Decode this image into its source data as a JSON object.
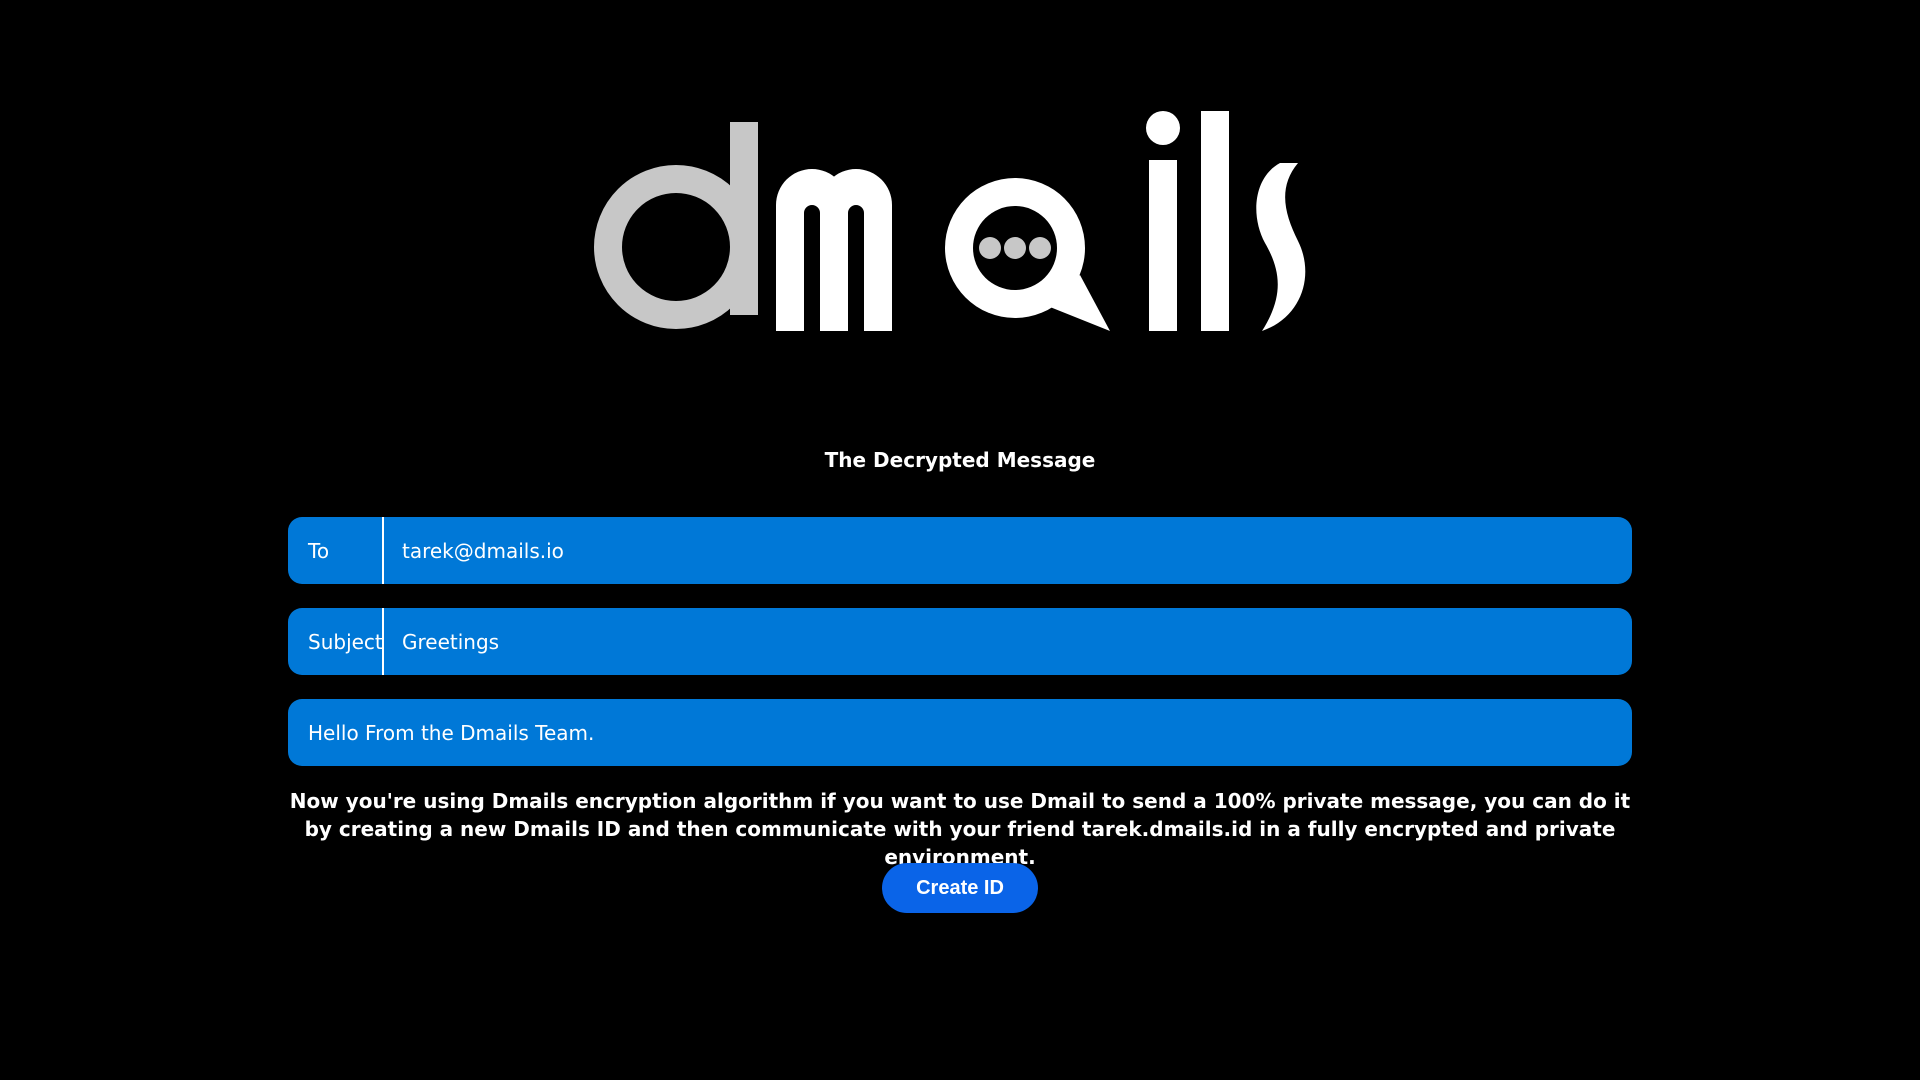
{
  "logo": {
    "text": "dmails",
    "colors": {
      "d": "#c7c7c7",
      "rest": "#ffffff",
      "dots": "#c7c7c7"
    }
  },
  "header": {
    "title": "The Decrypted Message"
  },
  "message": {
    "to_label": "To",
    "to_value": "tarek@dmails.io",
    "subject_label": "Subject",
    "subject_value": "Greetings",
    "body": "Hello From the Dmails Team."
  },
  "notice": {
    "text": "Now you're using Dmails encryption algorithm if you want to use Dmail to send a 100% private message, you can do it by creating a new Dmails ID and then communicate with your friend tarek.dmails.id in a fully encrypted and private environment."
  },
  "actions": {
    "create_id_label": "Create ID"
  },
  "colors": {
    "background": "#000000",
    "field_blue": "#0078d7",
    "button_blue": "#0a64e8",
    "text": "#ffffff"
  }
}
